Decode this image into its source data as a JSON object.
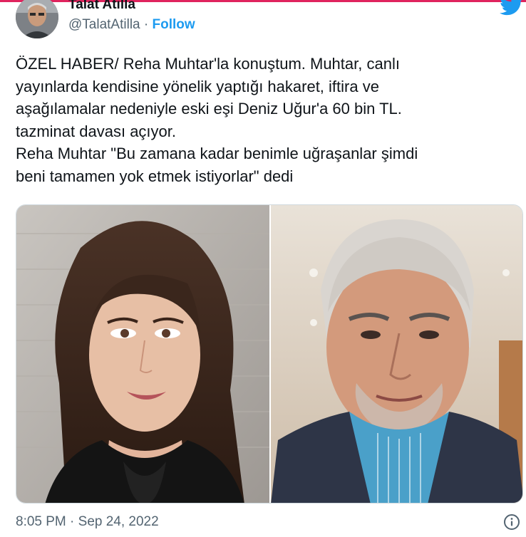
{
  "tweet": {
    "author_name": "Talat Atilla",
    "handle": "@TalatAtilla",
    "separator": "·",
    "follow_label": "Follow",
    "text_lines": [
      "ÖZEL HABER/ Reha Muhtar'la konuştum. Muhtar, canlı",
      "yayınlarda kendisine yönelik yaptığı hakaret, iftira ve",
      "aşağılamalar nedeniyle eski eşi Deniz Uğur'a 60 bin TL.",
      "tazminat davası açıyor.",
      "Reha Muhtar \"Bu zamana kadar benimle uğraşanlar şimdi",
      "beni tamamen yok etmek istiyorlar\" dedi"
    ],
    "timestamp": "8:05 PM · Sep 24, 2022"
  },
  "icons": {
    "brand": "twitter-bird-icon",
    "info": "info-icon"
  },
  "colors": {
    "accent": "#1d9bf0",
    "secondary_text": "#536471",
    "primary_text": "#0f1419",
    "top_rule": "#e0245e"
  }
}
